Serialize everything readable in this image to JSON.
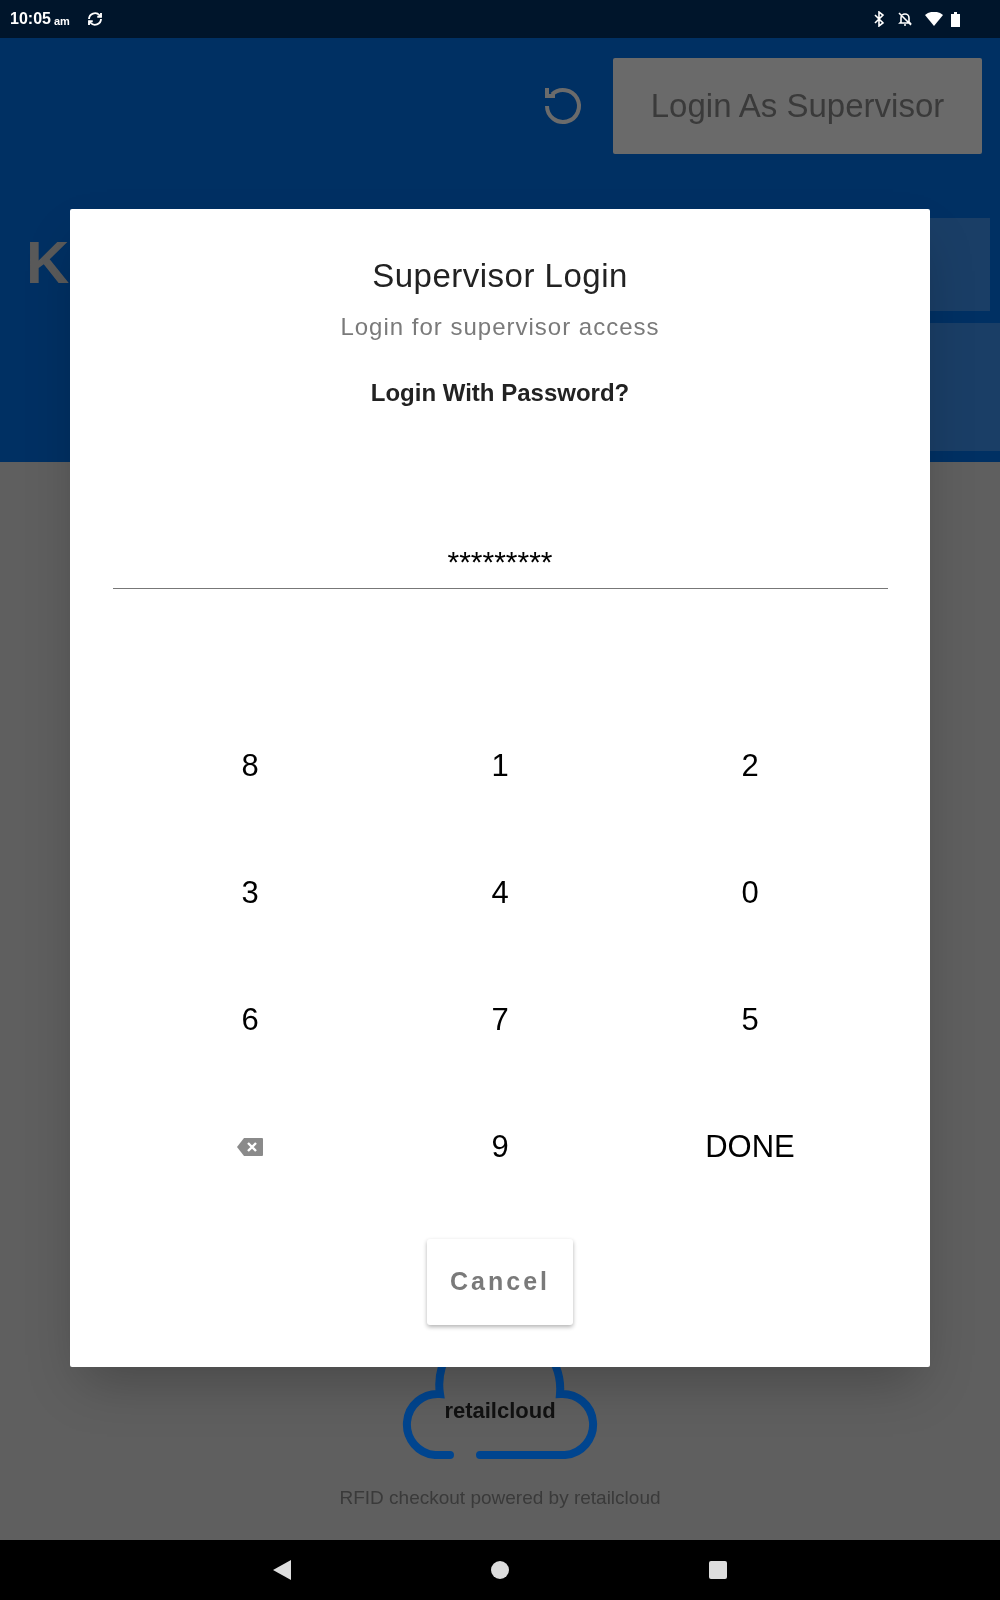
{
  "status_bar": {
    "time": "10:05",
    "ampm": "am"
  },
  "header": {
    "button": "Login As Supervisor",
    "disabled": true,
    "title": "K"
  },
  "dialog": {
    "title": "Supervisor Login",
    "subtitle": "Login for supervisor access",
    "prompt": "Login With Password?",
    "password": "*********",
    "keys": [
      {
        "kind": "digit",
        "label": "8"
      },
      {
        "kind": "digit",
        "label": "1"
      },
      {
        "kind": "digit",
        "label": "2"
      },
      {
        "kind": "digit",
        "label": "3"
      },
      {
        "kind": "digit",
        "label": "4"
      },
      {
        "kind": "digit",
        "label": "0"
      },
      {
        "kind": "digit",
        "label": "6"
      },
      {
        "kind": "digit",
        "label": "7"
      },
      {
        "kind": "digit",
        "label": "5"
      },
      {
        "kind": "backspace"
      },
      {
        "kind": "digit",
        "label": "9"
      },
      {
        "kind": "done",
        "label": "DONE"
      }
    ],
    "cancel": "Cancel"
  },
  "footer": {
    "logo": "retailcloud",
    "caption": "RFID checkout powered by retailcloud"
  }
}
